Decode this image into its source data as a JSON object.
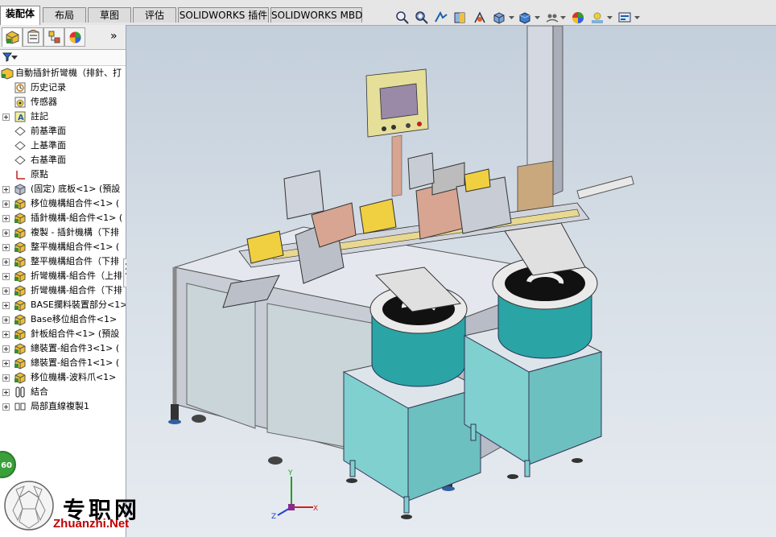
{
  "tabs": [
    {
      "label": "装配体",
      "active": true
    },
    {
      "label": "布局",
      "active": false
    },
    {
      "label": "草图",
      "active": false
    },
    {
      "label": "评估",
      "active": false
    },
    {
      "label": "SOLIDWORKS 插件",
      "active": false
    },
    {
      "label": "SOLIDWORKS MBD",
      "active": false
    }
  ],
  "hud_icons": [
    "zoom-to-fit-icon",
    "zoom-area-icon",
    "previous-view-icon",
    "section-view-icon",
    "dynamic-annotation-icon",
    "view-orientation-icon",
    "display-style-icon",
    "hide-show-icon",
    "edit-appearance-icon",
    "apply-scene-icon",
    "view-settings-icon"
  ],
  "pane": {
    "tabs": [
      "featuremanager-icon",
      "propertymanager-icon",
      "configurationmanager-icon",
      "displaymanager-icon"
    ],
    "expand_label": "»"
  },
  "tree": {
    "root": "自動插針折彎機（排針、打",
    "items": [
      {
        "label": "历史记录",
        "icon": "history-icon",
        "expand": false
      },
      {
        "label": "传感器",
        "icon": "sensor-icon",
        "expand": false
      },
      {
        "label": "註記",
        "icon": "annotation-icon",
        "expand": true
      },
      {
        "label": "前基準面",
        "icon": "plane-icon",
        "expand": false
      },
      {
        "label": "上基準面",
        "icon": "plane-icon",
        "expand": false
      },
      {
        "label": "右基準面",
        "icon": "plane-icon",
        "expand": false
      },
      {
        "label": "原點",
        "icon": "origin-icon",
        "expand": false
      },
      {
        "label": "(固定) 底板<1> (預設",
        "icon": "part-icon",
        "expand": true
      },
      {
        "label": "移位機構組合件<1> (",
        "icon": "subassembly-icon",
        "expand": true
      },
      {
        "label": "插針機構-組合件<1> (",
        "icon": "subassembly-icon",
        "expand": true
      },
      {
        "label": "複製 - 插針機構（下排",
        "icon": "subassembly-icon",
        "expand": true
      },
      {
        "label": "整平機構組合件<1> (",
        "icon": "subassembly-icon",
        "expand": true
      },
      {
        "label": "整平機構組合件（下排",
        "icon": "subassembly-icon",
        "expand": true
      },
      {
        "label": "折彎機構-組合件（上排",
        "icon": "subassembly-icon",
        "expand": true
      },
      {
        "label": "折彎機構-組合件（下排",
        "icon": "subassembly-icon",
        "expand": true
      },
      {
        "label": "BASE攔料裝置部分<1>",
        "icon": "subassembly-icon",
        "expand": true
      },
      {
        "label": "Base移位組合件<1>",
        "icon": "subassembly-icon",
        "expand": true
      },
      {
        "label": "針板組合件<1> (預設",
        "icon": "subassembly-icon",
        "expand": true
      },
      {
        "label": "總裝置-組合件3<1> (",
        "icon": "subassembly-icon",
        "expand": true
      },
      {
        "label": "總裝置-組合件1<1> (",
        "icon": "subassembly-icon",
        "expand": true
      },
      {
        "label": "移位機構-波料爪<1>",
        "icon": "subassembly-icon",
        "expand": true
      },
      {
        "label": "結合",
        "icon": "mates-icon",
        "expand": true
      },
      {
        "label": "局部直線複製1",
        "icon": "linear-pattern-icon",
        "expand": true
      }
    ]
  },
  "watermark": {
    "cn": "专职网",
    "en": "Zhuanzhi.Net",
    "badge": "60"
  },
  "triad": {
    "x": "X",
    "y": "Y",
    "z": "Z"
  },
  "colors": {
    "accent_blue": "#1c5fa8",
    "frame_gray": "#c8ccd4",
    "bowl_teal": "#2aa4a4",
    "stand_teal": "#7fd0cf"
  }
}
